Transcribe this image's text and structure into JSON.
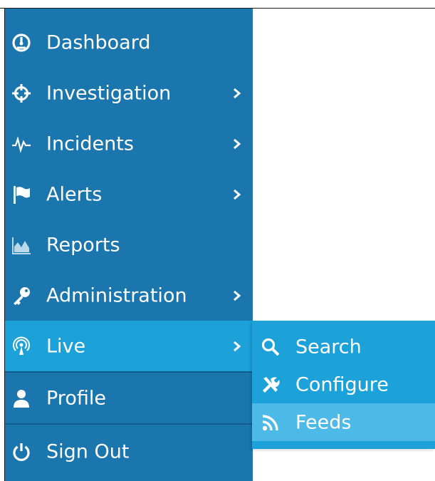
{
  "sidebar": {
    "items": [
      {
        "label": "Dashboard",
        "icon": "dashboard-gauge-icon",
        "has_submenu": false
      },
      {
        "label": "Investigation",
        "icon": "crosshair-icon",
        "has_submenu": true
      },
      {
        "label": "Incidents",
        "icon": "pulse-icon",
        "has_submenu": true
      },
      {
        "label": "Alerts",
        "icon": "flag-icon",
        "has_submenu": true
      },
      {
        "label": "Reports",
        "icon": "area-chart-icon",
        "has_submenu": false
      },
      {
        "label": "Administration",
        "icon": "key-icon",
        "has_submenu": true
      },
      {
        "label": "Live",
        "icon": "broadcast-icon",
        "has_submenu": true,
        "active": true
      },
      {
        "label": "Profile",
        "icon": "user-icon",
        "has_submenu": false
      },
      {
        "label": "Sign Out",
        "icon": "power-icon",
        "has_submenu": false
      }
    ]
  },
  "flyout": {
    "items": [
      {
        "label": "Search",
        "icon": "search-icon"
      },
      {
        "label": "Configure",
        "icon": "tools-icon"
      },
      {
        "label": "Feeds",
        "icon": "rss-icon",
        "highlighted": true
      }
    ]
  },
  "colors": {
    "sidebar_bg": "#1a76ad",
    "active_bg": "#1da1d9",
    "flyout_bg": "#1da1d9",
    "flyout_hover_bg": "#4cb9e6",
    "divider": "#105c8a",
    "text": "#ffffff"
  }
}
